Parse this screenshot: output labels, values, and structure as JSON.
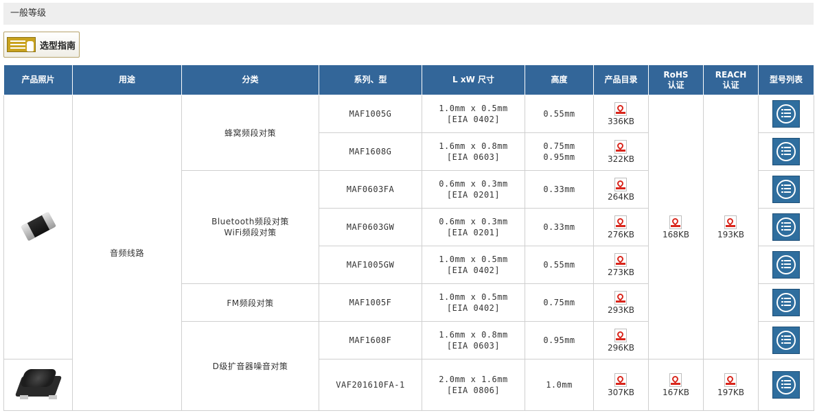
{
  "section_title": "一般等级",
  "guide_button": "选型指南",
  "headers": [
    "产品照片",
    "用途",
    "分类",
    "系列、型",
    "L xW 尺寸",
    "高度",
    "产品目录",
    "RoHS\n认证",
    "REACH\n认证",
    "型号列表"
  ],
  "usage": "音频线路",
  "categories": {
    "honeycomb": "蜂窝频段对策",
    "bt_line1": "Bluetooth频段对策",
    "bt_line2": "WiFi频段对策",
    "fm": "FM频段对策",
    "classd": "D级扩音器噪音对策"
  },
  "rows": [
    {
      "series": "MAF1005G",
      "dim1": "1.0mm x 0.5mm",
      "dim2": "[EIA 0402]",
      "h1": "0.55mm",
      "h2": "",
      "catalog": "336KB"
    },
    {
      "series": "MAF1608G",
      "dim1": "1.6mm x 0.8mm",
      "dim2": "[EIA 0603]",
      "h1": "0.75mm",
      "h2": "0.95mm",
      "catalog": "322KB"
    },
    {
      "series": "MAF0603FA",
      "dim1": "0.6mm x 0.3mm",
      "dim2": "[EIA 0201]",
      "h1": "0.33mm",
      "h2": "",
      "catalog": "264KB"
    },
    {
      "series": "MAF0603GW",
      "dim1": "0.6mm x 0.3mm",
      "dim2": "[EIA 0201]",
      "h1": "0.33mm",
      "h2": "",
      "catalog": "276KB"
    },
    {
      "series": "MAF1005GW",
      "dim1": "1.0mm x 0.5mm",
      "dim2": "[EIA 0402]",
      "h1": "0.55mm",
      "h2": "",
      "catalog": "273KB"
    },
    {
      "series": "MAF1005F",
      "dim1": "1.0mm x 0.5mm",
      "dim2": "[EIA 0402]",
      "h1": "0.75mm",
      "h2": "",
      "catalog": "293KB"
    },
    {
      "series": "MAF1608F",
      "dim1": "1.6mm x 0.8mm",
      "dim2": "[EIA 0603]",
      "h1": "0.95mm",
      "h2": "",
      "catalog": "296KB"
    },
    {
      "series": "VAF201610FA-1",
      "dim1": "2.0mm x 1.6mm",
      "dim2": "[EIA 0806]",
      "h1": "1.0mm",
      "h2": "",
      "catalog": "307KB"
    }
  ],
  "rohs": {
    "group1": "168KB",
    "vaf": "167KB"
  },
  "reach": {
    "group1": "193KB",
    "vaf": "197KB"
  },
  "icons": {
    "catalog": "pdf-icon",
    "list": "part-list-icon",
    "guide": "selection-guide-icon"
  },
  "colors": {
    "header_bg": "#336699",
    "accent": "#c9a31f",
    "pdf_red": "#d9261c"
  }
}
